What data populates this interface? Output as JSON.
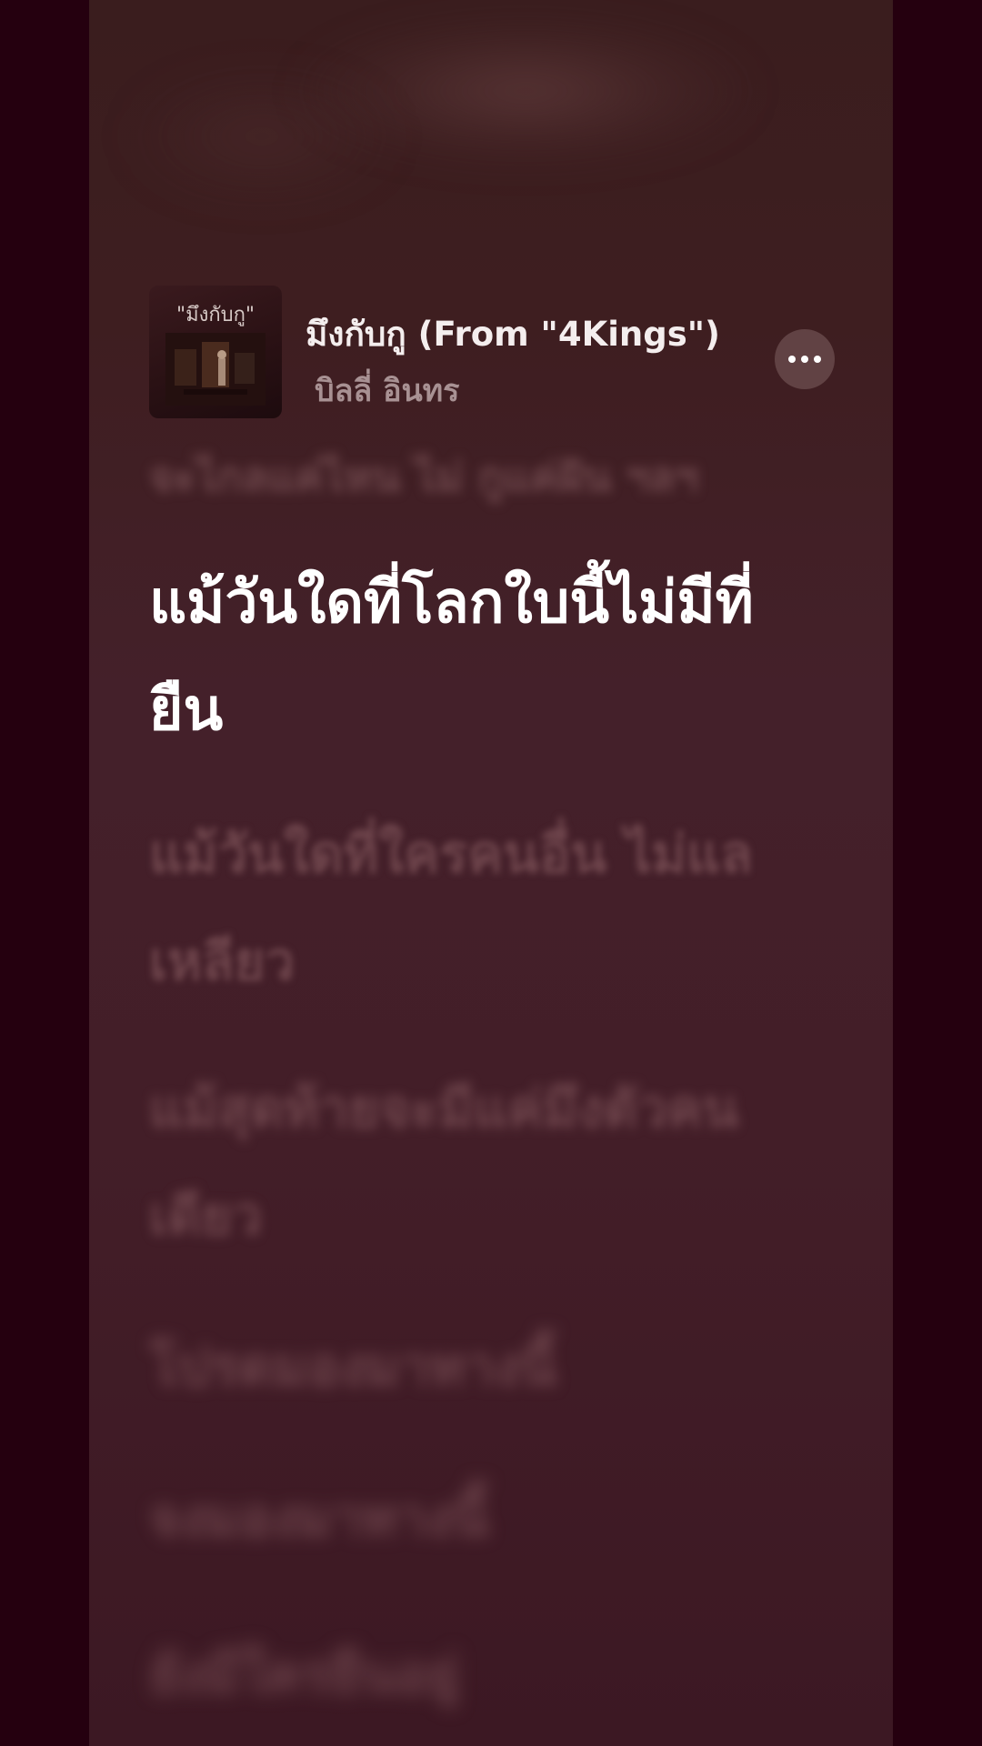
{
  "track": {
    "title": "มึงกับกู (From \"4Kings\")",
    "artist": "บิลลี่ อินทร",
    "artwork_text": "\"มึงกับกู\""
  },
  "more_button": {
    "icon": "ellipsis-icon"
  },
  "lyrics": {
    "previous": "จะไกลแค่ไหน ไม่ กูแค่ฝัน ฯลฯ",
    "current": "แม้วันใดที่โลกใบนี้ไม่มีที่ยืน",
    "upcoming": [
      "แม้วันใดที่ใครคนอื่น ไม่แลเหลียว",
      "แม้สุดท้ายจะมีแค่มึงตัวคนเดียว",
      "โปรดมองมาทางนี้",
      "จงมองมาทางนี้",
      "ยังมีใครยืนอยู่"
    ]
  },
  "colors": {
    "background": "#25000f",
    "panel": "#3e1e20",
    "lyric_active": "#ffffff",
    "artist_text": "#a89193"
  }
}
